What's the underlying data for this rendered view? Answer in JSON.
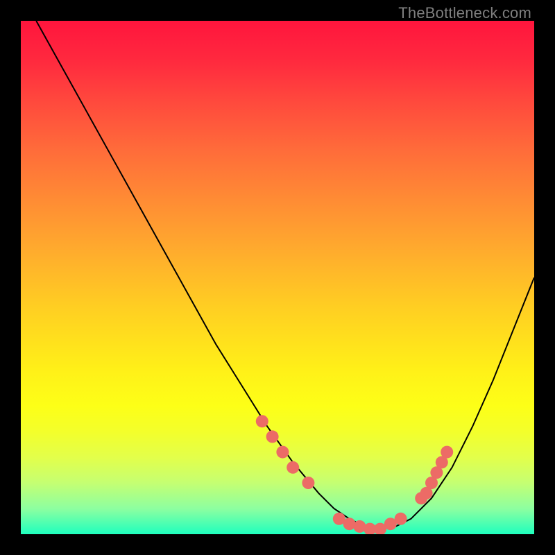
{
  "watermark": "TheBottleneck.com",
  "colors": {
    "marker": "#ec6b66",
    "curve": "#000000",
    "background": "#000000"
  },
  "chart_data": {
    "type": "line",
    "title": "",
    "xlabel": "",
    "ylabel": "",
    "xlim": [
      0,
      100
    ],
    "ylim": [
      0,
      100
    ],
    "curve": {
      "x": [
        3,
        8,
        13,
        18,
        23,
        28,
        33,
        38,
        43,
        48,
        53,
        58,
        61,
        64,
        67,
        70,
        73,
        76,
        80,
        84,
        88,
        92,
        96,
        100
      ],
      "y": [
        100,
        91,
        82,
        73,
        64,
        55,
        46,
        37,
        29,
        21,
        14,
        8,
        5,
        3,
        1.5,
        1,
        1.5,
        3,
        7,
        13,
        21,
        30,
        40,
        50
      ]
    },
    "markers": {
      "x": [
        47,
        49,
        51,
        53,
        56,
        62,
        64,
        66,
        68,
        70,
        72,
        74,
        78,
        79,
        80,
        81,
        82,
        83
      ],
      "y": [
        22,
        19,
        16,
        13,
        10,
        3,
        2,
        1.5,
        1,
        1,
        2,
        3,
        7,
        8,
        10,
        12,
        14,
        16
      ]
    }
  }
}
